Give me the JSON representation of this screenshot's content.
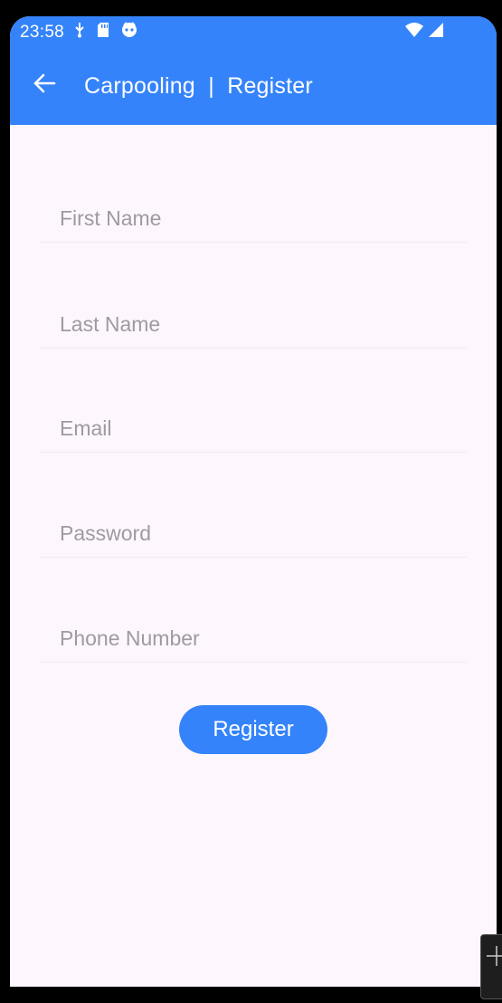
{
  "status_bar": {
    "time": "23:58",
    "left_icons": [
      "usb-debug-icon",
      "sd-card-icon",
      "app-notification-icon"
    ],
    "right_icons": [
      "wifi-icon",
      "cell-signal-icon"
    ]
  },
  "app_bar": {
    "title": "Carpooling  |  Register",
    "back_icon": "arrow-left-icon"
  },
  "form": {
    "first_name_placeholder": "First Name",
    "last_name_placeholder": "Last Name",
    "email_placeholder": "Email",
    "password_placeholder": "Password",
    "phone_placeholder": "Phone Number",
    "submit_label": "Register"
  },
  "colors": {
    "primary": "#3483fa",
    "background": "#fdf6fd",
    "placeholder": "#9d9ba0"
  }
}
